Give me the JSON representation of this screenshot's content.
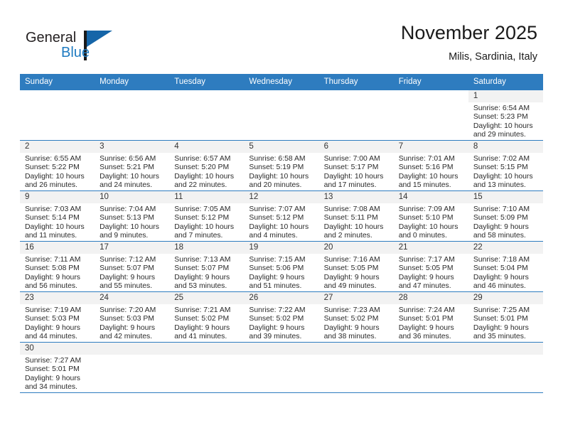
{
  "brand": {
    "name_part1": "General",
    "name_part2": "Blue",
    "logo_icon": "triangle-flag-icon"
  },
  "header": {
    "title": "November 2025",
    "subtitle": "Milis, Sardinia, Italy"
  },
  "colors": {
    "header_blue": "#2e7cbf",
    "logo_blue": "#1f7bc1",
    "daynum_band": "#f2f2f2"
  },
  "weekdays": [
    "Sunday",
    "Monday",
    "Tuesday",
    "Wednesday",
    "Thursday",
    "Friday",
    "Saturday"
  ],
  "labels": {
    "sunrise": "Sunrise:",
    "sunset": "Sunset:",
    "daylight": "Daylight:"
  },
  "weeks": [
    [
      {
        "blank": true
      },
      {
        "blank": true
      },
      {
        "blank": true
      },
      {
        "blank": true
      },
      {
        "blank": true
      },
      {
        "blank": true
      },
      {
        "day": "1",
        "sunrise": "Sunrise: 6:54 AM",
        "sunset": "Sunset: 5:23 PM",
        "daylight1": "Daylight: 10 hours",
        "daylight2": "and 29 minutes."
      }
    ],
    [
      {
        "day": "2",
        "sunrise": "Sunrise: 6:55 AM",
        "sunset": "Sunset: 5:22 PM",
        "daylight1": "Daylight: 10 hours",
        "daylight2": "and 26 minutes."
      },
      {
        "day": "3",
        "sunrise": "Sunrise: 6:56 AM",
        "sunset": "Sunset: 5:21 PM",
        "daylight1": "Daylight: 10 hours",
        "daylight2": "and 24 minutes."
      },
      {
        "day": "4",
        "sunrise": "Sunrise: 6:57 AM",
        "sunset": "Sunset: 5:20 PM",
        "daylight1": "Daylight: 10 hours",
        "daylight2": "and 22 minutes."
      },
      {
        "day": "5",
        "sunrise": "Sunrise: 6:58 AM",
        "sunset": "Sunset: 5:19 PM",
        "daylight1": "Daylight: 10 hours",
        "daylight2": "and 20 minutes."
      },
      {
        "day": "6",
        "sunrise": "Sunrise: 7:00 AM",
        "sunset": "Sunset: 5:17 PM",
        "daylight1": "Daylight: 10 hours",
        "daylight2": "and 17 minutes."
      },
      {
        "day": "7",
        "sunrise": "Sunrise: 7:01 AM",
        "sunset": "Sunset: 5:16 PM",
        "daylight1": "Daylight: 10 hours",
        "daylight2": "and 15 minutes."
      },
      {
        "day": "8",
        "sunrise": "Sunrise: 7:02 AM",
        "sunset": "Sunset: 5:15 PM",
        "daylight1": "Daylight: 10 hours",
        "daylight2": "and 13 minutes."
      }
    ],
    [
      {
        "day": "9",
        "sunrise": "Sunrise: 7:03 AM",
        "sunset": "Sunset: 5:14 PM",
        "daylight1": "Daylight: 10 hours",
        "daylight2": "and 11 minutes."
      },
      {
        "day": "10",
        "sunrise": "Sunrise: 7:04 AM",
        "sunset": "Sunset: 5:13 PM",
        "daylight1": "Daylight: 10 hours",
        "daylight2": "and 9 minutes."
      },
      {
        "day": "11",
        "sunrise": "Sunrise: 7:05 AM",
        "sunset": "Sunset: 5:12 PM",
        "daylight1": "Daylight: 10 hours",
        "daylight2": "and 7 minutes."
      },
      {
        "day": "12",
        "sunrise": "Sunrise: 7:07 AM",
        "sunset": "Sunset: 5:12 PM",
        "daylight1": "Daylight: 10 hours",
        "daylight2": "and 4 minutes."
      },
      {
        "day": "13",
        "sunrise": "Sunrise: 7:08 AM",
        "sunset": "Sunset: 5:11 PM",
        "daylight1": "Daylight: 10 hours",
        "daylight2": "and 2 minutes."
      },
      {
        "day": "14",
        "sunrise": "Sunrise: 7:09 AM",
        "sunset": "Sunset: 5:10 PM",
        "daylight1": "Daylight: 10 hours",
        "daylight2": "and 0 minutes."
      },
      {
        "day": "15",
        "sunrise": "Sunrise: 7:10 AM",
        "sunset": "Sunset: 5:09 PM",
        "daylight1": "Daylight: 9 hours",
        "daylight2": "and 58 minutes."
      }
    ],
    [
      {
        "day": "16",
        "sunrise": "Sunrise: 7:11 AM",
        "sunset": "Sunset: 5:08 PM",
        "daylight1": "Daylight: 9 hours",
        "daylight2": "and 56 minutes."
      },
      {
        "day": "17",
        "sunrise": "Sunrise: 7:12 AM",
        "sunset": "Sunset: 5:07 PM",
        "daylight1": "Daylight: 9 hours",
        "daylight2": "and 55 minutes."
      },
      {
        "day": "18",
        "sunrise": "Sunrise: 7:13 AM",
        "sunset": "Sunset: 5:07 PM",
        "daylight1": "Daylight: 9 hours",
        "daylight2": "and 53 minutes."
      },
      {
        "day": "19",
        "sunrise": "Sunrise: 7:15 AM",
        "sunset": "Sunset: 5:06 PM",
        "daylight1": "Daylight: 9 hours",
        "daylight2": "and 51 minutes."
      },
      {
        "day": "20",
        "sunrise": "Sunrise: 7:16 AM",
        "sunset": "Sunset: 5:05 PM",
        "daylight1": "Daylight: 9 hours",
        "daylight2": "and 49 minutes."
      },
      {
        "day": "21",
        "sunrise": "Sunrise: 7:17 AM",
        "sunset": "Sunset: 5:05 PM",
        "daylight1": "Daylight: 9 hours",
        "daylight2": "and 47 minutes."
      },
      {
        "day": "22",
        "sunrise": "Sunrise: 7:18 AM",
        "sunset": "Sunset: 5:04 PM",
        "daylight1": "Daylight: 9 hours",
        "daylight2": "and 46 minutes."
      }
    ],
    [
      {
        "day": "23",
        "sunrise": "Sunrise: 7:19 AM",
        "sunset": "Sunset: 5:03 PM",
        "daylight1": "Daylight: 9 hours",
        "daylight2": "and 44 minutes."
      },
      {
        "day": "24",
        "sunrise": "Sunrise: 7:20 AM",
        "sunset": "Sunset: 5:03 PM",
        "daylight1": "Daylight: 9 hours",
        "daylight2": "and 42 minutes."
      },
      {
        "day": "25",
        "sunrise": "Sunrise: 7:21 AM",
        "sunset": "Sunset: 5:02 PM",
        "daylight1": "Daylight: 9 hours",
        "daylight2": "and 41 minutes."
      },
      {
        "day": "26",
        "sunrise": "Sunrise: 7:22 AM",
        "sunset": "Sunset: 5:02 PM",
        "daylight1": "Daylight: 9 hours",
        "daylight2": "and 39 minutes."
      },
      {
        "day": "27",
        "sunrise": "Sunrise: 7:23 AM",
        "sunset": "Sunset: 5:02 PM",
        "daylight1": "Daylight: 9 hours",
        "daylight2": "and 38 minutes."
      },
      {
        "day": "28",
        "sunrise": "Sunrise: 7:24 AM",
        "sunset": "Sunset: 5:01 PM",
        "daylight1": "Daylight: 9 hours",
        "daylight2": "and 36 minutes."
      },
      {
        "day": "29",
        "sunrise": "Sunrise: 7:25 AM",
        "sunset": "Sunset: 5:01 PM",
        "daylight1": "Daylight: 9 hours",
        "daylight2": "and 35 minutes."
      }
    ],
    [
      {
        "day": "30",
        "sunrise": "Sunrise: 7:27 AM",
        "sunset": "Sunset: 5:01 PM",
        "daylight1": "Daylight: 9 hours",
        "daylight2": "and 34 minutes."
      },
      {
        "empty": true
      },
      {
        "empty": true
      },
      {
        "empty": true
      },
      {
        "empty": true
      },
      {
        "empty": true
      },
      {
        "empty": true
      }
    ]
  ]
}
